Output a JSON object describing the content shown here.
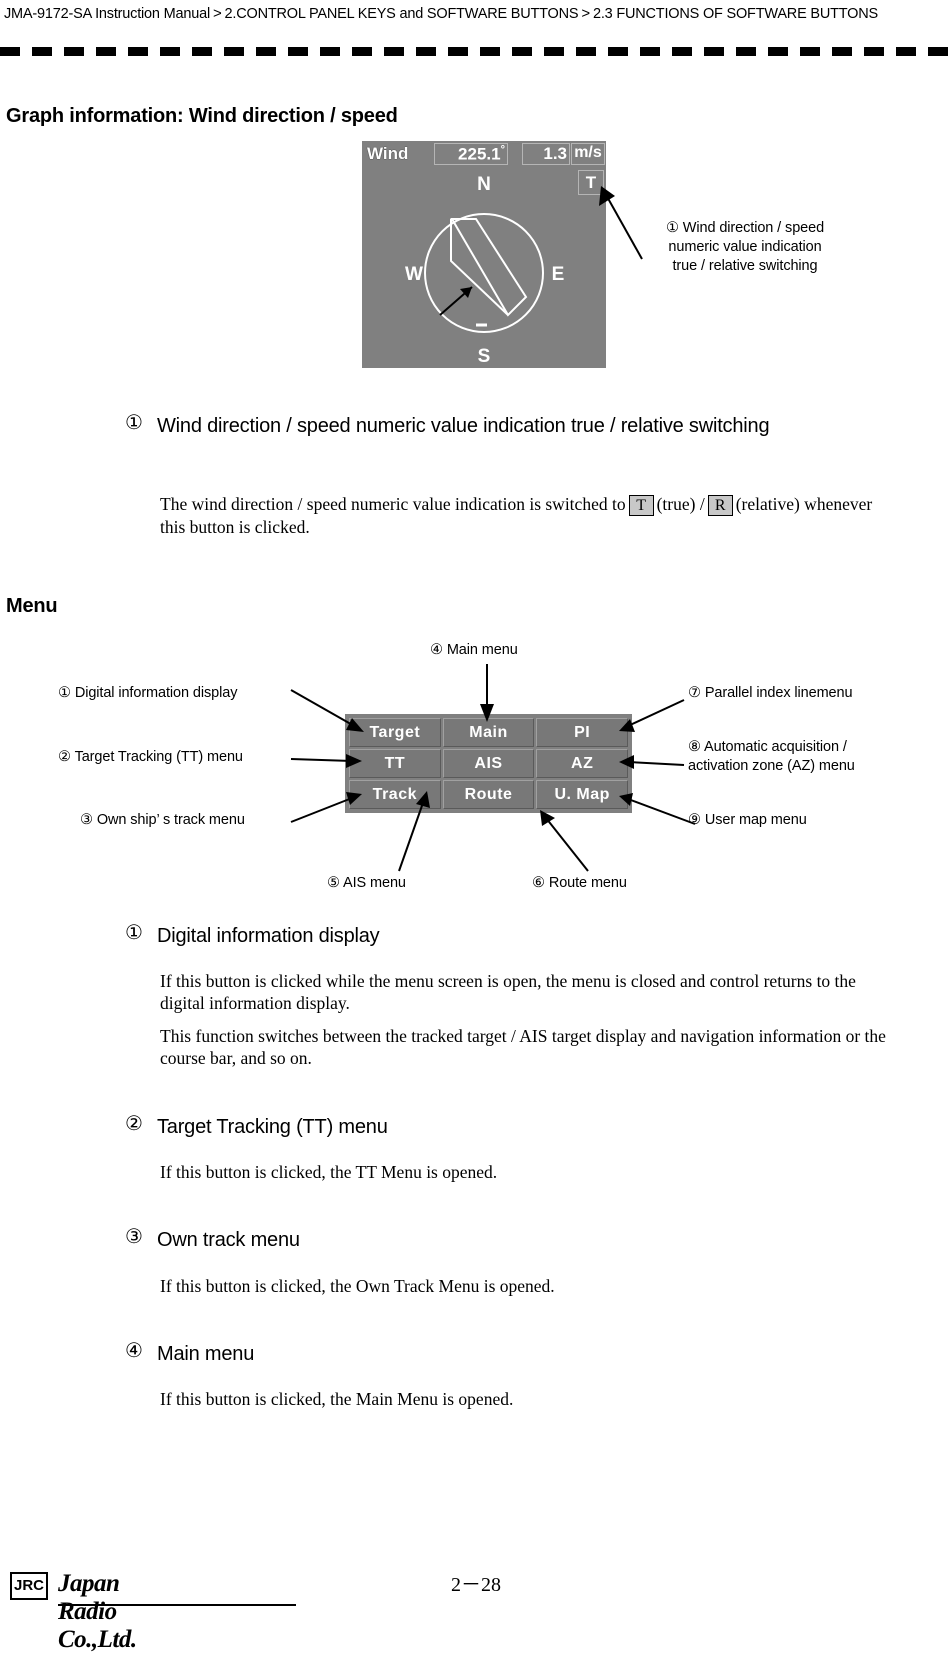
{
  "header": {
    "manual": "JMA-9172-SA Instruction Manual",
    "sep": ">",
    "chapter": "2.CONTROL PANEL KEYS and SOFTWARE BUTTONS",
    "section": "2.3  FUNCTIONS OF SOFTWARE BUTTONS"
  },
  "wind_section": {
    "heading": "Graph information: Wind direction / speed",
    "panel": {
      "label": "Wind",
      "direction_value": "225.1",
      "direction_unit": "°",
      "speed_value": "1.3",
      "speed_unit": "m/s",
      "mode_button": "T",
      "compass": {
        "north": "N",
        "west": "W",
        "east": "E",
        "south": "S"
      }
    },
    "callout": {
      "number": "①",
      "line1": "Wind direction / speed",
      "line2": "numeric value indication",
      "line3": "true / relative switching"
    },
    "item": {
      "number": "①",
      "title": "Wind direction / speed numeric value indication true / relative switching",
      "body_part1": "The wind direction / speed numeric value indication is switched to",
      "key_true": "T",
      "body_part2": "(true) /",
      "key_relative": "R",
      "body_part3": "(relative) whenever this button is clicked."
    }
  },
  "menu_section": {
    "heading": "Menu",
    "buttons": [
      [
        "Target",
        "Main",
        "PI"
      ],
      [
        "TT",
        "AIS",
        "AZ"
      ],
      [
        "Track",
        "Route",
        "U. Map"
      ]
    ],
    "callouts": {
      "c1": "① Digital information display",
      "c2": "② Target Tracking (TT) menu",
      "c3": "③ Own ship’ s track menu",
      "c4": "④ Main menu",
      "c5": "⑤ AIS menu",
      "c6": "⑥ Route menu",
      "c7": "⑦ Parallel index linemenu",
      "c8_line1": "⑧ Automatic acquisition /",
      "c8_line2": "activation zone (AZ) menu",
      "c9": "⑨ User map menu"
    },
    "items": [
      {
        "number": "①",
        "title": "Digital information display",
        "paragraphs": [
          "If this button is clicked while the menu screen is open, the menu is closed and control returns to the digital information display.",
          "This function switches between the tracked target / AIS target display and navigation information or the course bar, and so on."
        ]
      },
      {
        "number": "②",
        "title": "Target Tracking (TT) menu",
        "paragraphs": [
          "If this button is clicked, the TT Menu is opened."
        ]
      },
      {
        "number": "③",
        "title": "Own track menu",
        "paragraphs": [
          "If this button is clicked, the Own Track Menu is opened."
        ]
      },
      {
        "number": "④",
        "title": "Main menu",
        "paragraphs": [
          "If this button is clicked, the Main Menu is opened."
        ]
      }
    ]
  },
  "footer": {
    "page_number": "2－28",
    "logo_mark": "JRC",
    "company": "Japan Radio Co.,Ltd."
  }
}
